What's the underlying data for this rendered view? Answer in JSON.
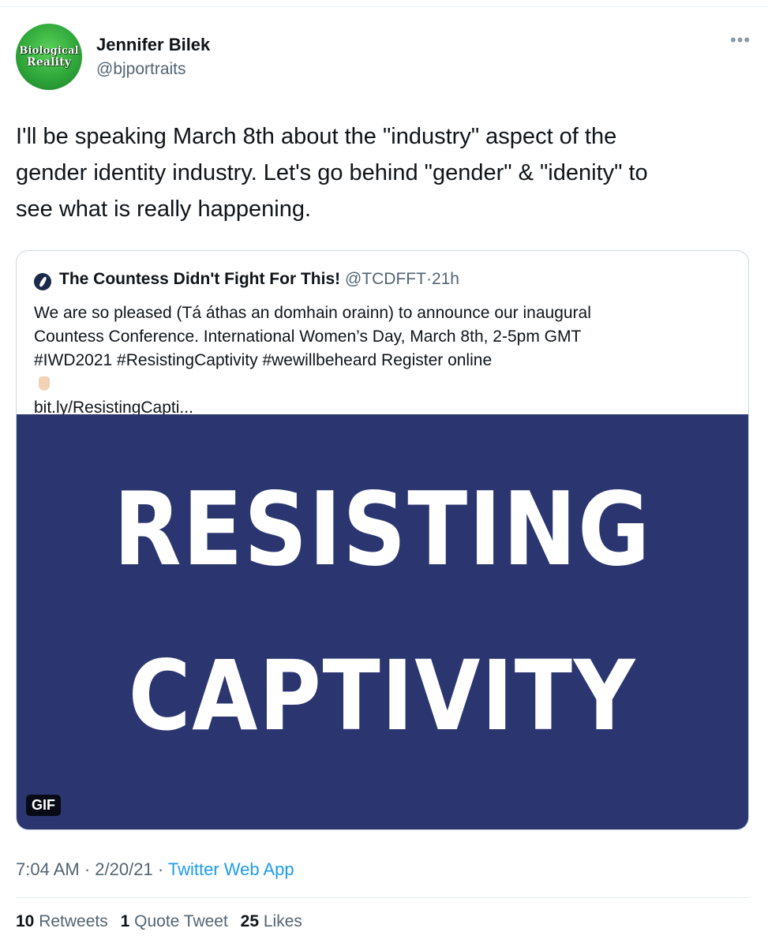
{
  "author": {
    "display_name": "Jennifer Bilek",
    "handle": "@bjportraits",
    "avatar_text_line1": "Biological",
    "avatar_text_line2": "Reality"
  },
  "more_icon": "more-dots-icon",
  "tweet": {
    "text_lines": [
      "I'll be speaking March 8th about the \"industry\" aspect of the",
      "gender identity industry.  Let's go behind \"gender\" &  \"idenity\" to",
      "see what is really happening."
    ]
  },
  "quote": {
    "name": "The Countess Didn't Fight For This!",
    "handle": "@TCDFFT",
    "separator": "·",
    "time": "21h",
    "text_lines": [
      "We are so pleased (Tá áthas an domhain orainn) to announce our inaugural",
      "Countess Conference. International Women’s Day, March 8th, 2-5pm GMT",
      "#IWD2021 #ResistingCaptivity #wewillbeheard Register online",
      "bit.ly/ResistingCapti..."
    ],
    "gif_line1": "RESISTING",
    "gif_line2": "CAPTIVITY",
    "gif_badge": "GIF",
    "gif_bg_color": "#2b3670"
  },
  "meta": {
    "time": "7:04 AM",
    "sep1": "·",
    "date": "2/20/21",
    "sep2": "·",
    "source": "Twitter Web App",
    "link_color": "#1d9bf0"
  },
  "stats": {
    "retweets_count": "10",
    "retweets_label": "Retweets",
    "quotes_count": "1",
    "quotes_label": "Quote Tweet",
    "likes_count": "25",
    "likes_label": "Likes"
  }
}
